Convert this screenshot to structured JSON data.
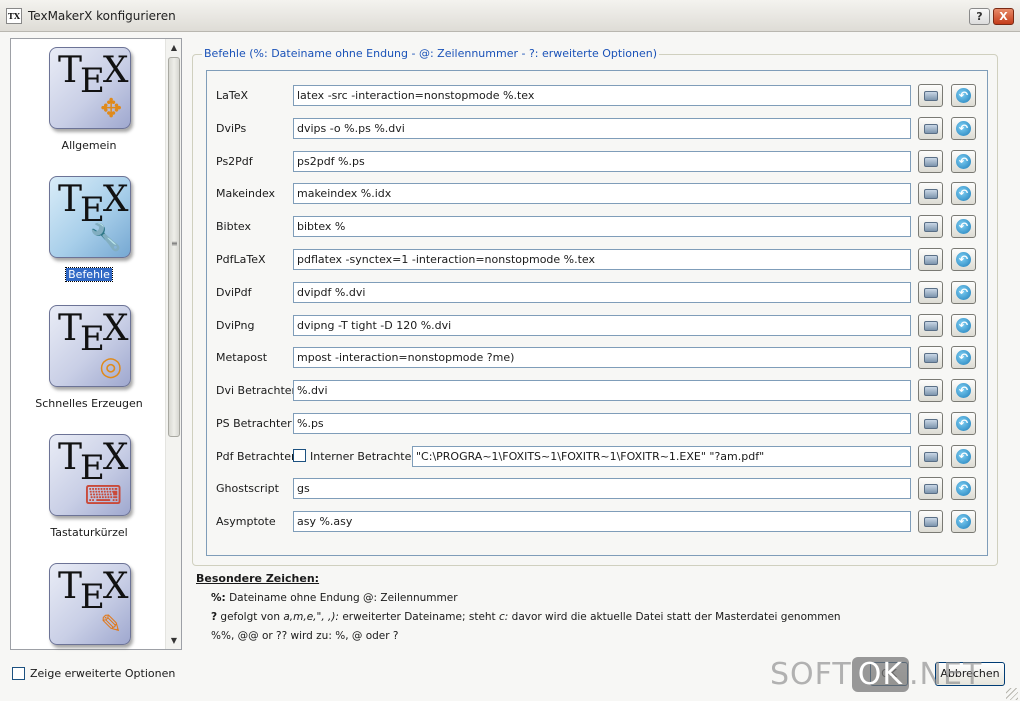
{
  "window": {
    "title": "TexMakerX konfigurieren",
    "help_label": "?",
    "close_label": "X"
  },
  "sidebar": {
    "items": [
      {
        "label": "Allgemein",
        "icon": "tex-move-icon",
        "badge": "✥"
      },
      {
        "label": "Befehle",
        "icon": "tex-wrench-icon",
        "badge": "🔧",
        "selected": true
      },
      {
        "label": "Schnelles Erzeugen",
        "icon": "tex-spiral-icon",
        "badge": "◎"
      },
      {
        "label": "Tastaturkürzel",
        "icon": "tex-keyboard-icon",
        "badge": "⌨"
      },
      {
        "label": "",
        "icon": "tex-pencil-icon",
        "badge": "✎"
      }
    ],
    "show_advanced_label": "Zeige erweiterte Optionen"
  },
  "commands": {
    "group_title": "Befehle (%: Dateiname ohne Endung - @: Zeilennummer - ?: erweiterte Optionen)",
    "rows": [
      {
        "label": "LaTeX",
        "value": "latex -src -interaction=nonstopmode %.tex"
      },
      {
        "label": "DviPs",
        "value": "dvips -o %.ps %.dvi"
      },
      {
        "label": "Ps2Pdf",
        "value": "ps2pdf %.ps"
      },
      {
        "label": "Makeindex",
        "value": "makeindex %.idx"
      },
      {
        "label": "Bibtex",
        "value": "bibtex %"
      },
      {
        "label": "PdfLaTeX",
        "value": "pdflatex -synctex=1 -interaction=nonstopmode %.tex"
      },
      {
        "label": "DviPdf",
        "value": "dvipdf %.dvi"
      },
      {
        "label": "DviPng",
        "value": "dvipng -T tight -D 120 %.dvi"
      },
      {
        "label": "Metapost",
        "value": "mpost -interaction=nonstopmode ?me)"
      },
      {
        "label": "Dvi Betrachter",
        "value": "%.dvi"
      },
      {
        "label": "PS Betrachter",
        "value": "%.ps"
      },
      {
        "label": "Pdf Betrachter",
        "value": "\"C:\\PROGRA~1\\FOXITS~1\\FOXITR~1\\FOXITR~1.EXE\" \"?am.pdf\"",
        "internal_label": "Interner Betrachter"
      },
      {
        "label": "Ghostscript",
        "value": "gs"
      },
      {
        "label": "Asymptote",
        "value": "asy %.asy"
      }
    ]
  },
  "special": {
    "title": "Besondere Zeichen:",
    "line1_key": "%:",
    "line1_text": " Dateiname ohne Endung @: Zeilennummer",
    "line2_key": "?",
    "line2_text": " gefolgt von ",
    "line2_ital": "a,m,e,\", ,):",
    "line2_text2": " erweiterter Dateiname; steht ",
    "line2_ital2": "c:",
    "line2_text3": " davor wird die aktuelle Datei statt der Masterdatei genommen",
    "line3": "%%, @@ or ?? wird zu: %, @ oder ?"
  },
  "buttons": {
    "ok": "OK",
    "cancel": "Abbrechen"
  },
  "watermark": {
    "left": "SOFT",
    "ok": "OK",
    "right": ".NET"
  }
}
